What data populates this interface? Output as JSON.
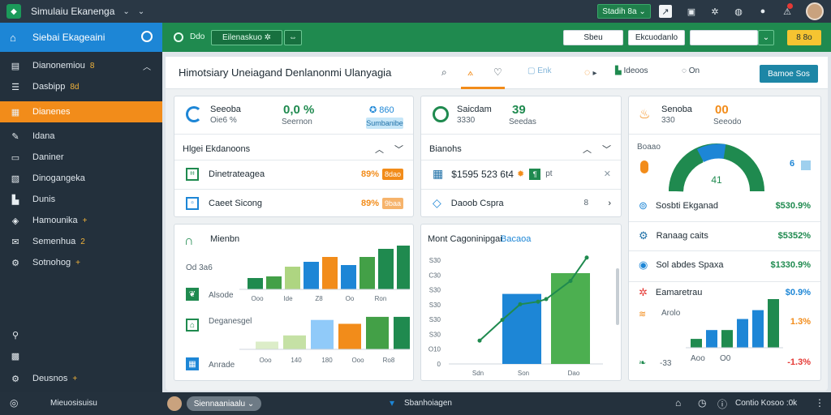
{
  "topbar": {
    "app_title": "Simulaiu Ekanenga",
    "select_label": "Stadih 8a",
    "colors": {
      "bg": "#2a3845",
      "accent": "#1f8a4f"
    }
  },
  "sidebar": {
    "header": "Siebai Ekageaini",
    "items": [
      {
        "label": "Dianonemiou",
        "tag": "8",
        "icon": "dashboard-icon"
      },
      {
        "label": "Dasbipp",
        "tag": "8d",
        "icon": "list-icon"
      },
      {
        "label": "Dianenes",
        "tag": "",
        "icon": "calendar-icon",
        "active": true
      },
      {
        "label": "Idana",
        "tag": "",
        "icon": "edit-icon"
      },
      {
        "label": "Daniner",
        "tag": "",
        "icon": "folder-icon"
      },
      {
        "label": "Dinogangeka",
        "tag": "",
        "icon": "layers-icon"
      },
      {
        "label": "Dunis",
        "tag": "",
        "icon": "chart-icon"
      },
      {
        "label": "Hamounika",
        "tag": "+",
        "icon": "shield-icon"
      },
      {
        "label": "Semenhua",
        "tag": "2",
        "icon": "mail-icon"
      },
      {
        "label": "Sotnohog",
        "tag": "+",
        "icon": "gear-icon"
      }
    ],
    "bottom": [
      {
        "label": "",
        "icon": "pin-icon"
      },
      {
        "label": "",
        "icon": "gift-icon"
      },
      {
        "label": "Deusnos",
        "tag": "+",
        "icon": "gear-icon"
      },
      {
        "label": "Mieuosisuisu",
        "icon": "user-icon"
      }
    ]
  },
  "toolbar": {
    "left_label": "Ddo",
    "filter_label": "Eilenaskuo",
    "btn1": "Sbeu",
    "btn2": "Ekcuodanlo",
    "btn3": "",
    "btn4": "8 8o"
  },
  "page": {
    "title": "Himotsiary Uneiagand Denlanonmi Ulanyagia",
    "tabs": [
      "Enk",
      "Ideoos",
      "On"
    ],
    "export_label": "Bamoe Sos"
  },
  "kpis": [
    {
      "label": "Seeoba",
      "sub": "Oie6 %",
      "value": "0,0 %",
      "value_sub": "Seernon",
      "badge": "860",
      "badge2": "Sumbanibe",
      "color": "#1d86d6"
    },
    {
      "label": "Saicdam",
      "sub": "3330",
      "value": "39",
      "value_sub": "Seedas",
      "color": "#1f8a4f"
    },
    {
      "label": "Senoba",
      "sub": "330",
      "value": "00",
      "value_sub": "Seeodo",
      "color": "#f28c1a"
    }
  ],
  "list_card": {
    "header": "Hlgei Ekdanoons",
    "rows": [
      {
        "label": "Dinetrateagea",
        "value": "89%",
        "pill": "8dao",
        "color": "#1f8a4f"
      },
      {
        "label": "Caeet Sicong",
        "value": "89%",
        "pill": "9baa",
        "color": "#1d86d6"
      }
    ]
  },
  "mid_card": {
    "header": "Bianohs",
    "rows": [
      {
        "label": "$1595 523 6t4",
        "extra": "pt",
        "color": "#1f8a4f"
      },
      {
        "label": "Daoob Cspra",
        "extra": "8",
        "color": "#1d86d6"
      }
    ]
  },
  "right_card": {
    "header": "Boaao",
    "gauge_value": "41",
    "gauge_badge": "6",
    "items": [
      {
        "label": "Sosbti Ekganad",
        "value": "$530.9%",
        "color": "#1f8a4f"
      },
      {
        "label": "Ranaag caits",
        "value": "$5352%",
        "color": "#1d86d6"
      },
      {
        "label": "Sol abdes Spaxa",
        "value": "$1330.9%",
        "color": "#1d86d6"
      },
      {
        "label": "Eamaretrau",
        "value": "$0.9%",
        "color": "#e53935"
      }
    ]
  },
  "bar_card_1": {
    "title": "Mienbn",
    "side_labels": [
      "Od 3a6",
      "Alsode",
      "Deganesgel",
      "Anrade"
    ],
    "chart_data": {
      "type": "bar",
      "categories": [
        "Ooo",
        "Ide",
        "Z8",
        "Oo",
        "Ron"
      ],
      "values": [
        14,
        16,
        28,
        34,
        40,
        30,
        40,
        50,
        54
      ],
      "colors": [
        "#1f8a4f",
        "#43a047",
        "#aed581",
        "#1d86d6",
        "#f28c1a",
        "#1d86d6",
        "#43a047",
        "#1f8a4f",
        "#1f8a4f"
      ]
    },
    "chart_data_2": {
      "type": "bar",
      "categories": [
        "Ooo",
        "140",
        "180",
        "Ooo",
        "Ro8"
      ],
      "values": [
        10,
        18,
        38,
        33,
        42,
        42
      ],
      "colors": [
        "#dcedc8",
        "#c5e1a5",
        "#90caf9",
        "#f28c1a",
        "#43a047",
        "#1f8a4f"
      ]
    }
  },
  "combo_card": {
    "title": "Mont Cagoninipgai",
    "subtitle": "Bacaoa",
    "chart_data": {
      "type": "bar",
      "categories": [
        "Sdn",
        "Son",
        "Dao"
      ],
      "y_ticks": [
        "S30",
        "C30",
        "S30",
        "S30",
        "S30",
        "S30",
        "O10",
        "0"
      ],
      "bars": [
        {
          "value": 270,
          "color": "#1d86d6"
        },
        {
          "value": 350,
          "color": "#4caf50"
        }
      ],
      "line": [
        90,
        170,
        230,
        240,
        250,
        320,
        410
      ],
      "ylim": [
        0,
        400
      ]
    }
  },
  "right_bars": {
    "labels": [
      "Aoo",
      "Arolo",
      "-33",
      "O0"
    ],
    "values_text": [
      "1.3%",
      "-1.3%"
    ],
    "chart_data": {
      "type": "bar",
      "values": [
        8,
        16,
        16,
        26,
        34,
        44
      ],
      "colors": [
        "#1f8a4f",
        "#1d86d6",
        "#1f8a4f",
        "#1d86d6",
        "#1d86d6",
        "#1f8a4f"
      ]
    }
  },
  "bottombar": {
    "select_label": "Siennaaniaalu",
    "center_label": "Sbanhoiagen",
    "right_label": "Contio Kosoo :0k"
  }
}
